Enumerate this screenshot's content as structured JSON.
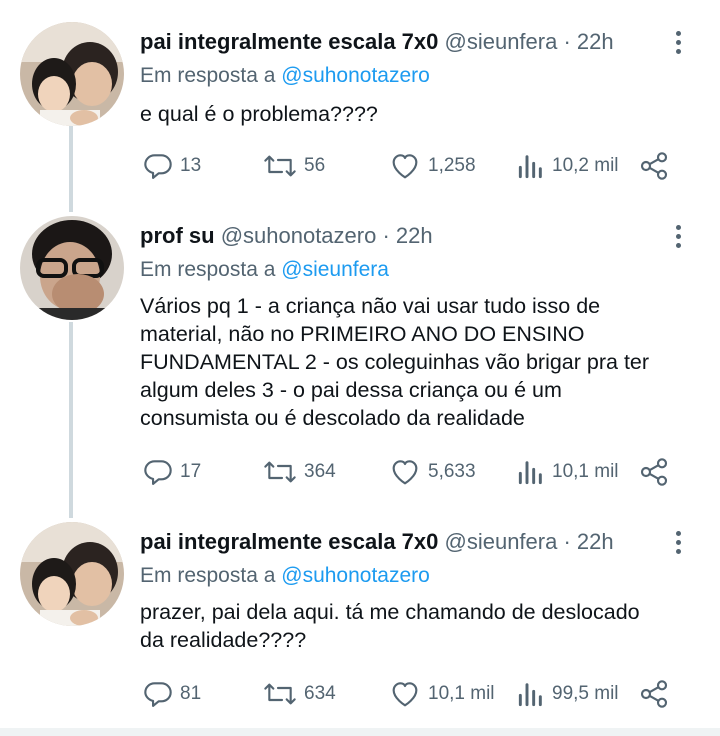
{
  "tweets": [
    {
      "name": "pai integralmente escala 7x0",
      "handle": "@sieunfera",
      "sep": "·",
      "time": "22h",
      "reply_prefix": "Em resposta a",
      "reply_to": "@suhonotazero",
      "text_lines": [
        "e qual é o problema????"
      ],
      "replies": "13",
      "retweets": "56",
      "likes": "1,258",
      "views": "10,2 mil"
    },
    {
      "name": "prof su",
      "handle": "@suhonotazero",
      "sep": "·",
      "time": "22h",
      "reply_prefix": "Em resposta a",
      "reply_to": "@sieunfera",
      "text_lines": [
        "Vários pq 1 - a criança não vai usar tudo isso de",
        "material, não no PRIMEIRO ANO DO ENSINO",
        "FUNDAMENTAL 2 - os coleguinhas vão brigar pra ter",
        "algum deles 3 - o pai dessa criança ou é um",
        "consumista ou é descolado da realidade"
      ],
      "replies": "17",
      "retweets": "364",
      "likes": "5,633",
      "views": "10,1 mil"
    },
    {
      "name": "pai integralmente escala 7x0",
      "handle": "@sieunfera",
      "sep": "·",
      "time": "22h",
      "reply_prefix": "Em resposta a",
      "reply_to": "@suhonotazero",
      "text_lines": [
        "prazer, pai dela aqui. tá me chamando de deslocado",
        "da realidade????"
      ],
      "replies": "81",
      "retweets": "634",
      "likes": "10,1 mil",
      "views": "99,5 mil"
    }
  ],
  "icons": {
    "reply": "reply-icon",
    "retweet": "retweet-icon",
    "like": "heart-icon",
    "views": "views-icon",
    "share": "share-icon",
    "more": "more-icon"
  },
  "colors": {
    "link": "#1d9bf0",
    "secondary": "#536471",
    "thread_line": "#cfd9de"
  }
}
